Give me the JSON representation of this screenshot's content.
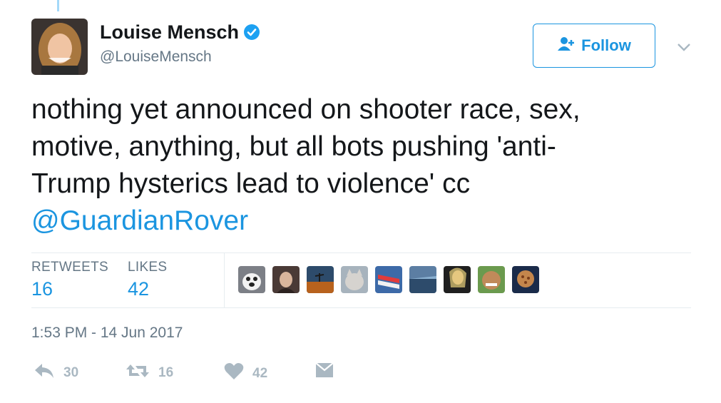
{
  "user": {
    "name": "Louise Mensch",
    "handle": "@LouiseMensch"
  },
  "follow_label": "Follow",
  "tweet": {
    "text_lines": [
      "nothing yet announced on shooter race, sex,",
      "motive, anything, but all bots pushing 'anti-",
      "Trump hysterics lead to violence' cc"
    ],
    "mention": "@GuardianRover"
  },
  "stats": {
    "retweets_label": "RETWEETS",
    "retweets_value": "16",
    "likes_label": "LIKES",
    "likes_value": "42"
  },
  "timestamp": "1:53 PM - 14 Jun 2017",
  "actions": {
    "reply_count": "30",
    "retweet_count": "16",
    "like_count": "42"
  },
  "colors": {
    "accent": "#1b95e0",
    "muted": "#657786",
    "icon": "#aab8c2",
    "text": "#14171a"
  },
  "icons": [
    "verified-badge-icon",
    "follow-user-icon",
    "chevron-down-icon",
    "reply-icon",
    "retweet-icon",
    "heart-icon",
    "direct-message-icon"
  ]
}
